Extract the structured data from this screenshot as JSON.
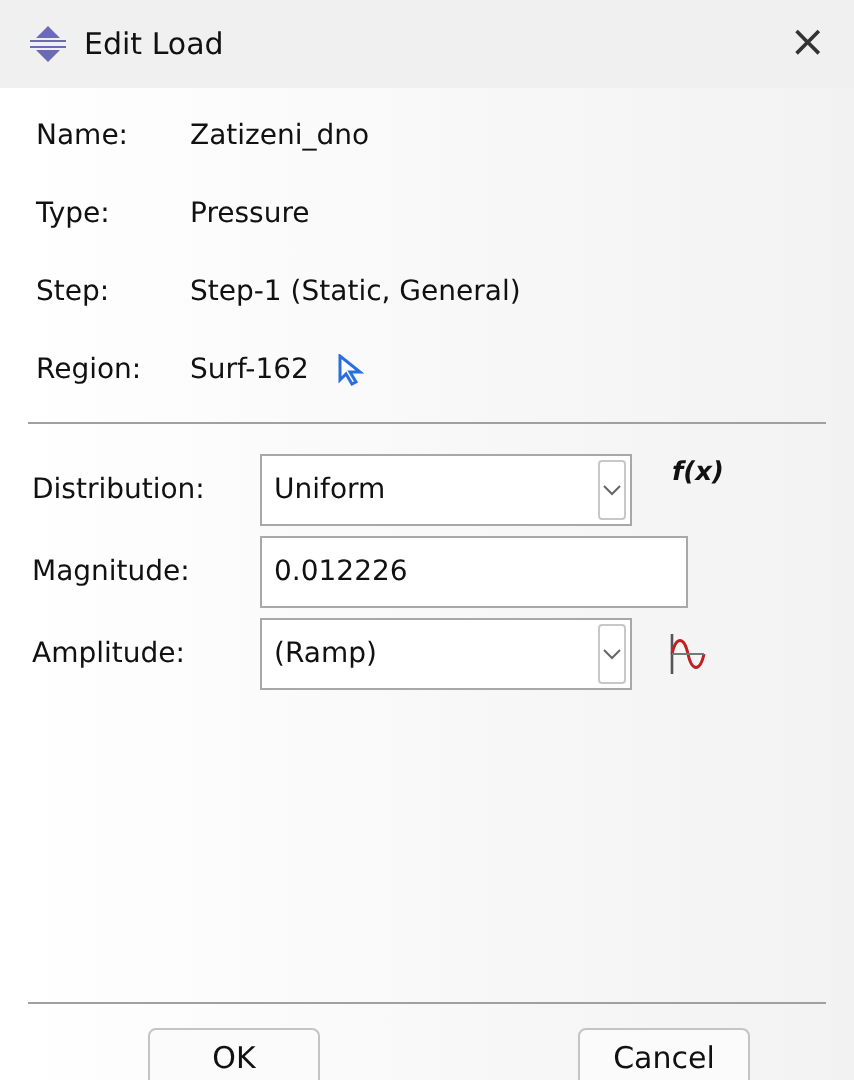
{
  "window": {
    "title": "Edit Load",
    "close": "×"
  },
  "info": [
    {
      "label": "Name:",
      "value": "Zatizeni_dno"
    },
    {
      "label": "Type:",
      "value": "Pressure"
    },
    {
      "label": "Step:",
      "value": "Step-1 (Static, General)"
    },
    {
      "label": "Region:",
      "value": "Surf-162",
      "pick": true
    }
  ],
  "fields": [
    {
      "label": "Distribution:",
      "kind": "dropdown",
      "value": "Uniform",
      "button": {
        "kind": "function",
        "text": "f(x)"
      }
    },
    {
      "label": "Magnitude:",
      "kind": "text",
      "value": "0.012226"
    },
    {
      "label": "Amplitude:",
      "kind": "dropdown",
      "value": "(Ramp)",
      "button": {
        "kind": "amplitude"
      }
    }
  ],
  "buttons": [
    "OK",
    "Cancel"
  ]
}
